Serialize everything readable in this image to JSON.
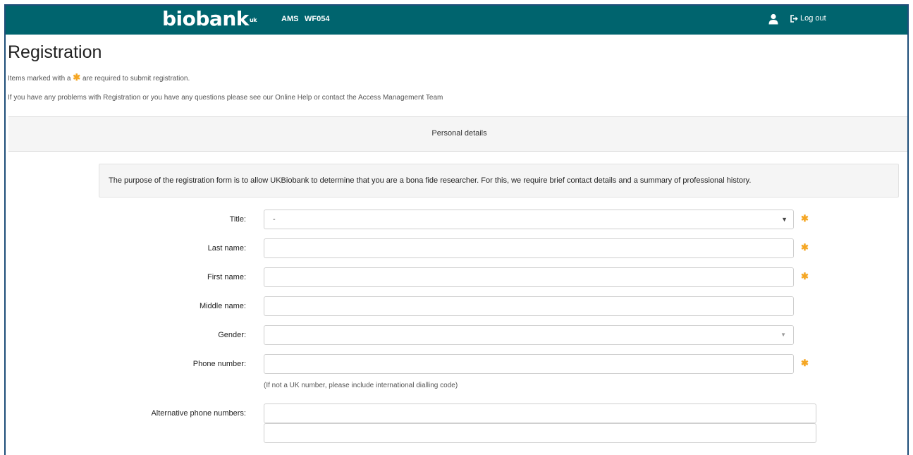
{
  "navbar": {
    "logo_text": "biobank",
    "logo_sup": "uk",
    "links": [
      "AMS",
      "WF054"
    ],
    "logout_label": "Log out"
  },
  "page": {
    "title": "Registration",
    "required_note_before": "Items marked with a",
    "required_note_after": "are required to submit registration.",
    "help_note": "If you have any problems with Registration or you have any questions please see our Online Help or contact the Access Management Team"
  },
  "section": {
    "title": "Personal details",
    "info": "The purpose of the registration form is to allow UKBiobank to determine that you are a bona fide researcher. For this, we require brief contact details and a summary of professional history."
  },
  "form": {
    "title": {
      "label": "Title:",
      "value": "-"
    },
    "last_name": {
      "label": "Last name:",
      "value": ""
    },
    "first_name": {
      "label": "First name:",
      "value": ""
    },
    "middle_name": {
      "label": "Middle name:",
      "value": ""
    },
    "gender": {
      "label": "Gender:",
      "value": ""
    },
    "phone": {
      "label": "Phone number:",
      "value": "",
      "hint": "(If not a UK number, please include international dialling code)"
    },
    "alt_phone": {
      "label": "Alternative phone numbers:",
      "values": [
        "",
        ""
      ]
    }
  },
  "icons": {
    "required": "asterisk-icon",
    "user": "user-icon",
    "logout": "logout-icon"
  },
  "colors": {
    "navbar": "#00646e",
    "required_star": "#f5a623"
  }
}
